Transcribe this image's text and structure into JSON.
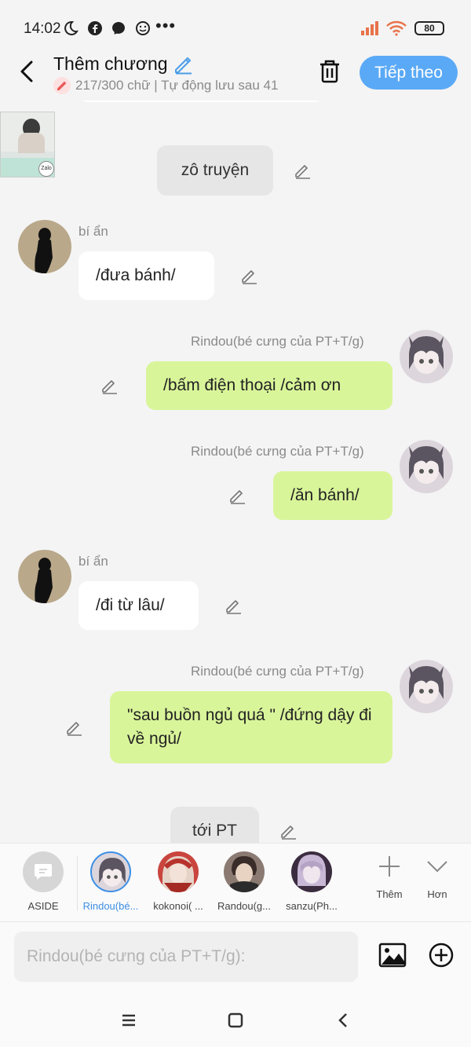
{
  "status": {
    "time": "14:02",
    "battery": "80"
  },
  "header": {
    "title": "Thêm chương",
    "subtitle": "217/300 chữ | Tự động lưu sau 41",
    "next_label": "Tiếp theo"
  },
  "messages": [
    {
      "kind": "narration",
      "text": "zô truyện"
    },
    {
      "kind": "left",
      "name": "bí ẩn",
      "text": "/đưa bánh/"
    },
    {
      "kind": "right",
      "name": "Rindou(bé cưng của PT+T/g)",
      "text": "/bấm điện thoại /cảm ơn"
    },
    {
      "kind": "right",
      "name": "Rindou(bé cưng của PT+T/g)",
      "text": "/ăn bánh/"
    },
    {
      "kind": "left",
      "name": "bí ẩn",
      "text": "/đi từ lâu/"
    },
    {
      "kind": "right",
      "name": "Rindou(bé cưng của PT+T/g)",
      "text": "\"sau buồn ngủ quá \" /đứng dậy đi về ngủ/"
    },
    {
      "kind": "narration",
      "text": "tới PT"
    }
  ],
  "thumbnail": {
    "label": "Zalo"
  },
  "characters": [
    {
      "label": "ASIDE",
      "icon": "chat-bubble-icon"
    },
    {
      "label": "Rindou(bé...",
      "active": true
    },
    {
      "label": "kokonoi( ..."
    },
    {
      "label": "Randou(g..."
    },
    {
      "label": "sanzu(Ph..."
    }
  ],
  "tools": {
    "add_label": "Thêm",
    "more_label": "Hơn"
  },
  "input": {
    "placeholder": "Rindou(bé cưng của PT+T/g):"
  },
  "colors": {
    "accent": "#5aa9f6",
    "right_bubble": "#d9f59a",
    "left_bubble": "#ffffff"
  }
}
